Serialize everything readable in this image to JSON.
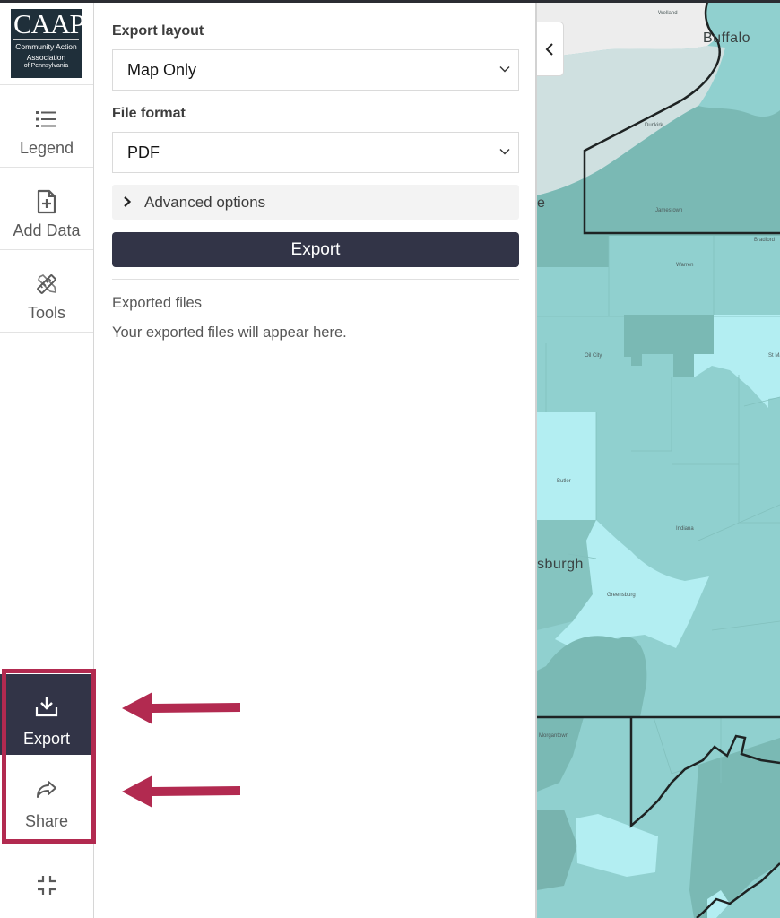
{
  "colors": {
    "accent_dark": "#323447",
    "highlight": "#b22a50",
    "panel_bg": "#ffffff",
    "map_light": "#b3eef2",
    "map_mid": "#90d0cf",
    "map_dark": "#7ab9b4",
    "map_water": "#cfe0e0"
  },
  "logo": {
    "title": "CAAP",
    "line1": "Community Action",
    "line2": "Association",
    "line3": "of Pennsylvania"
  },
  "sidebar": {
    "items": [
      {
        "label": "Legend",
        "icon": "list-icon"
      },
      {
        "label": "Add Data",
        "icon": "add-file-icon"
      },
      {
        "label": "Tools",
        "icon": "ruler-pencil-icon"
      }
    ],
    "bottom_items": [
      {
        "label": "Export",
        "icon": "download-icon",
        "active": true
      },
      {
        "label": "Share",
        "icon": "share-arrow-icon",
        "active": false
      }
    ],
    "collapse_icon": "minimize-icon"
  },
  "panel": {
    "export_layout": {
      "label": "Export layout",
      "value": "Map Only"
    },
    "file_format": {
      "label": "File format",
      "value": "PDF"
    },
    "advanced_options": "Advanced options",
    "export_button": "Export",
    "exported_files_title": "Exported files",
    "exported_files_empty": "Your exported files will appear here."
  },
  "map": {
    "collapse_button_icon": "chevron-left-icon",
    "labels": [
      {
        "text": "Welland",
        "size": "small"
      },
      {
        "text": "Buffalo",
        "size": "large"
      },
      {
        "text": "Dunkirk",
        "size": "small"
      },
      {
        "text": "Jamestown",
        "size": "small"
      },
      {
        "text": "Bradford",
        "size": "small"
      },
      {
        "text": "Warren",
        "size": "small"
      },
      {
        "text": "Oil City",
        "size": "small"
      },
      {
        "text": "St Ma",
        "size": "small"
      },
      {
        "text": "Butler",
        "size": "small"
      },
      {
        "text": "Indiana",
        "size": "small"
      },
      {
        "text": "sburgh",
        "size": "large"
      },
      {
        "text": "e",
        "size": "large"
      },
      {
        "text": "Greensburg",
        "size": "small"
      },
      {
        "text": "Morgantown",
        "size": "small"
      }
    ]
  },
  "annotations": {
    "arrows": [
      "export-pointer",
      "share-pointer"
    ]
  }
}
